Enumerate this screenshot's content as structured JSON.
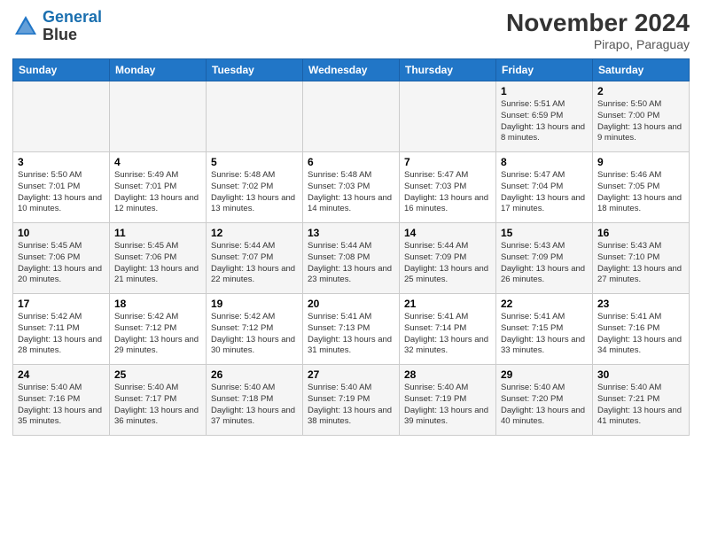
{
  "header": {
    "logo_line1": "General",
    "logo_line2": "Blue",
    "month": "November 2024",
    "location": "Pirapo, Paraguay"
  },
  "days_of_week": [
    "Sunday",
    "Monday",
    "Tuesday",
    "Wednesday",
    "Thursday",
    "Friday",
    "Saturday"
  ],
  "weeks": [
    [
      {
        "day": "",
        "info": ""
      },
      {
        "day": "",
        "info": ""
      },
      {
        "day": "",
        "info": ""
      },
      {
        "day": "",
        "info": ""
      },
      {
        "day": "",
        "info": ""
      },
      {
        "day": "1",
        "info": "Sunrise: 5:51 AM\nSunset: 6:59 PM\nDaylight: 13 hours and 8 minutes."
      },
      {
        "day": "2",
        "info": "Sunrise: 5:50 AM\nSunset: 7:00 PM\nDaylight: 13 hours and 9 minutes."
      }
    ],
    [
      {
        "day": "3",
        "info": "Sunrise: 5:50 AM\nSunset: 7:01 PM\nDaylight: 13 hours and 10 minutes."
      },
      {
        "day": "4",
        "info": "Sunrise: 5:49 AM\nSunset: 7:01 PM\nDaylight: 13 hours and 12 minutes."
      },
      {
        "day": "5",
        "info": "Sunrise: 5:48 AM\nSunset: 7:02 PM\nDaylight: 13 hours and 13 minutes."
      },
      {
        "day": "6",
        "info": "Sunrise: 5:48 AM\nSunset: 7:03 PM\nDaylight: 13 hours and 14 minutes."
      },
      {
        "day": "7",
        "info": "Sunrise: 5:47 AM\nSunset: 7:03 PM\nDaylight: 13 hours and 16 minutes."
      },
      {
        "day": "8",
        "info": "Sunrise: 5:47 AM\nSunset: 7:04 PM\nDaylight: 13 hours and 17 minutes."
      },
      {
        "day": "9",
        "info": "Sunrise: 5:46 AM\nSunset: 7:05 PM\nDaylight: 13 hours and 18 minutes."
      }
    ],
    [
      {
        "day": "10",
        "info": "Sunrise: 5:45 AM\nSunset: 7:06 PM\nDaylight: 13 hours and 20 minutes."
      },
      {
        "day": "11",
        "info": "Sunrise: 5:45 AM\nSunset: 7:06 PM\nDaylight: 13 hours and 21 minutes."
      },
      {
        "day": "12",
        "info": "Sunrise: 5:44 AM\nSunset: 7:07 PM\nDaylight: 13 hours and 22 minutes."
      },
      {
        "day": "13",
        "info": "Sunrise: 5:44 AM\nSunset: 7:08 PM\nDaylight: 13 hours and 23 minutes."
      },
      {
        "day": "14",
        "info": "Sunrise: 5:44 AM\nSunset: 7:09 PM\nDaylight: 13 hours and 25 minutes."
      },
      {
        "day": "15",
        "info": "Sunrise: 5:43 AM\nSunset: 7:09 PM\nDaylight: 13 hours and 26 minutes."
      },
      {
        "day": "16",
        "info": "Sunrise: 5:43 AM\nSunset: 7:10 PM\nDaylight: 13 hours and 27 minutes."
      }
    ],
    [
      {
        "day": "17",
        "info": "Sunrise: 5:42 AM\nSunset: 7:11 PM\nDaylight: 13 hours and 28 minutes."
      },
      {
        "day": "18",
        "info": "Sunrise: 5:42 AM\nSunset: 7:12 PM\nDaylight: 13 hours and 29 minutes."
      },
      {
        "day": "19",
        "info": "Sunrise: 5:42 AM\nSunset: 7:12 PM\nDaylight: 13 hours and 30 minutes."
      },
      {
        "day": "20",
        "info": "Sunrise: 5:41 AM\nSunset: 7:13 PM\nDaylight: 13 hours and 31 minutes."
      },
      {
        "day": "21",
        "info": "Sunrise: 5:41 AM\nSunset: 7:14 PM\nDaylight: 13 hours and 32 minutes."
      },
      {
        "day": "22",
        "info": "Sunrise: 5:41 AM\nSunset: 7:15 PM\nDaylight: 13 hours and 33 minutes."
      },
      {
        "day": "23",
        "info": "Sunrise: 5:41 AM\nSunset: 7:16 PM\nDaylight: 13 hours and 34 minutes."
      }
    ],
    [
      {
        "day": "24",
        "info": "Sunrise: 5:40 AM\nSunset: 7:16 PM\nDaylight: 13 hours and 35 minutes."
      },
      {
        "day": "25",
        "info": "Sunrise: 5:40 AM\nSunset: 7:17 PM\nDaylight: 13 hours and 36 minutes."
      },
      {
        "day": "26",
        "info": "Sunrise: 5:40 AM\nSunset: 7:18 PM\nDaylight: 13 hours and 37 minutes."
      },
      {
        "day": "27",
        "info": "Sunrise: 5:40 AM\nSunset: 7:19 PM\nDaylight: 13 hours and 38 minutes."
      },
      {
        "day": "28",
        "info": "Sunrise: 5:40 AM\nSunset: 7:19 PM\nDaylight: 13 hours and 39 minutes."
      },
      {
        "day": "29",
        "info": "Sunrise: 5:40 AM\nSunset: 7:20 PM\nDaylight: 13 hours and 40 minutes."
      },
      {
        "day": "30",
        "info": "Sunrise: 5:40 AM\nSunset: 7:21 PM\nDaylight: 13 hours and 41 minutes."
      }
    ]
  ]
}
